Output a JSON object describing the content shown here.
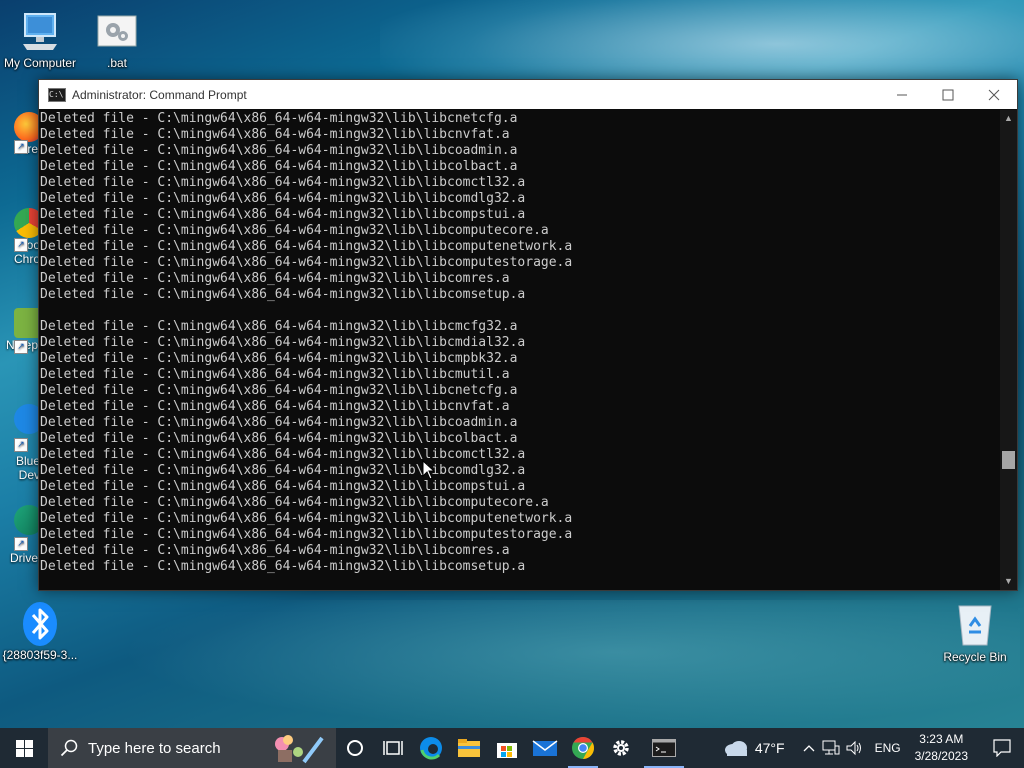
{
  "desktop": {
    "icons": [
      {
        "label": "My Computer",
        "icon": "computer-icon"
      },
      {
        "label": ".bat",
        "icon": "batch-file-icon"
      },
      {
        "label": "{28803f59-3...",
        "icon": "bluetooth-icon"
      },
      {
        "label": "Recycle Bin",
        "icon": "recycle-bin-icon"
      }
    ],
    "partial_icons": [
      {
        "label": "Fire",
        "icon": "firefox-icon",
        "color": "#ff6a1e"
      },
      {
        "label": "Goo Chro",
        "icon": "chrome-icon",
        "color": "#34a853"
      },
      {
        "label": "Notep",
        "icon": "notepad-icon",
        "color": "#7cb342"
      },
      {
        "label": "Blue Dev",
        "icon": "bluetooth-devices-icon",
        "color": "#1e88e5"
      },
      {
        "label": "Drive",
        "icon": "drive-icon",
        "color": "#1fa67a"
      }
    ]
  },
  "window": {
    "title": "Administrator: Command Prompt",
    "app_icon_text": "C:\\",
    "lines": [
      "Deleted file - C:\\mingw64\\x86_64-w64-mingw32\\lib\\libcnetcfg.a",
      "Deleted file - C:\\mingw64\\x86_64-w64-mingw32\\lib\\libcnvfat.a",
      "Deleted file - C:\\mingw64\\x86_64-w64-mingw32\\lib\\libcoadmin.a",
      "Deleted file - C:\\mingw64\\x86_64-w64-mingw32\\lib\\libcolbact.a",
      "Deleted file - C:\\mingw64\\x86_64-w64-mingw32\\lib\\libcomctl32.a",
      "Deleted file - C:\\mingw64\\x86_64-w64-mingw32\\lib\\libcomdlg32.a",
      "Deleted file - C:\\mingw64\\x86_64-w64-mingw32\\lib\\libcompstui.a",
      "Deleted file - C:\\mingw64\\x86_64-w64-mingw32\\lib\\libcomputecore.a",
      "Deleted file - C:\\mingw64\\x86_64-w64-mingw32\\lib\\libcomputenetwork.a",
      "Deleted file - C:\\mingw64\\x86_64-w64-mingw32\\lib\\libcomputestorage.a",
      "Deleted file - C:\\mingw64\\x86_64-w64-mingw32\\lib\\libcomres.a",
      "Deleted file - C:\\mingw64\\x86_64-w64-mingw32\\lib\\libcomsetup.a",
      "",
      "Deleted file - C:\\mingw64\\x86_64-w64-mingw32\\lib\\libcmcfg32.a",
      "Deleted file - C:\\mingw64\\x86_64-w64-mingw32\\lib\\libcmdial32.a",
      "Deleted file - C:\\mingw64\\x86_64-w64-mingw32\\lib\\libcmpbk32.a",
      "Deleted file - C:\\mingw64\\x86_64-w64-mingw32\\lib\\libcmutil.a",
      "Deleted file - C:\\mingw64\\x86_64-w64-mingw32\\lib\\libcnetcfg.a",
      "Deleted file - C:\\mingw64\\x86_64-w64-mingw32\\lib\\libcnvfat.a",
      "Deleted file - C:\\mingw64\\x86_64-w64-mingw32\\lib\\libcoadmin.a",
      "Deleted file - C:\\mingw64\\x86_64-w64-mingw32\\lib\\libcolbact.a",
      "Deleted file - C:\\mingw64\\x86_64-w64-mingw32\\lib\\libcomctl32.a",
      "Deleted file - C:\\mingw64\\x86_64-w64-mingw32\\lib\\libcomdlg32.a",
      "Deleted file - C:\\mingw64\\x86_64-w64-mingw32\\lib\\libcompstui.a",
      "Deleted file - C:\\mingw64\\x86_64-w64-mingw32\\lib\\libcomputecore.a",
      "Deleted file - C:\\mingw64\\x86_64-w64-mingw32\\lib\\libcomputenetwork.a",
      "Deleted file - C:\\mingw64\\x86_64-w64-mingw32\\lib\\libcomputestorage.a",
      "Deleted file - C:\\mingw64\\x86_64-w64-mingw32\\lib\\libcomres.a",
      "Deleted file - C:\\mingw64\\x86_64-w64-mingw32\\lib\\libcomsetup.a"
    ],
    "text_color": "#cccccc",
    "background_color": "#0c0c0c"
  },
  "taskbar": {
    "search_placeholder": "Type here to search",
    "pinned": [
      "cortana-icon",
      "task-view-icon",
      "edge-icon",
      "file-explorer-icon",
      "store-icon",
      "mail-icon",
      "chrome-icon",
      "settings-icon",
      "command-prompt-icon"
    ],
    "weather": {
      "temp": "47°F",
      "icon": "cloud-icon"
    },
    "language": "ENG",
    "time": "3:23 AM",
    "date": "3/28/2023"
  }
}
